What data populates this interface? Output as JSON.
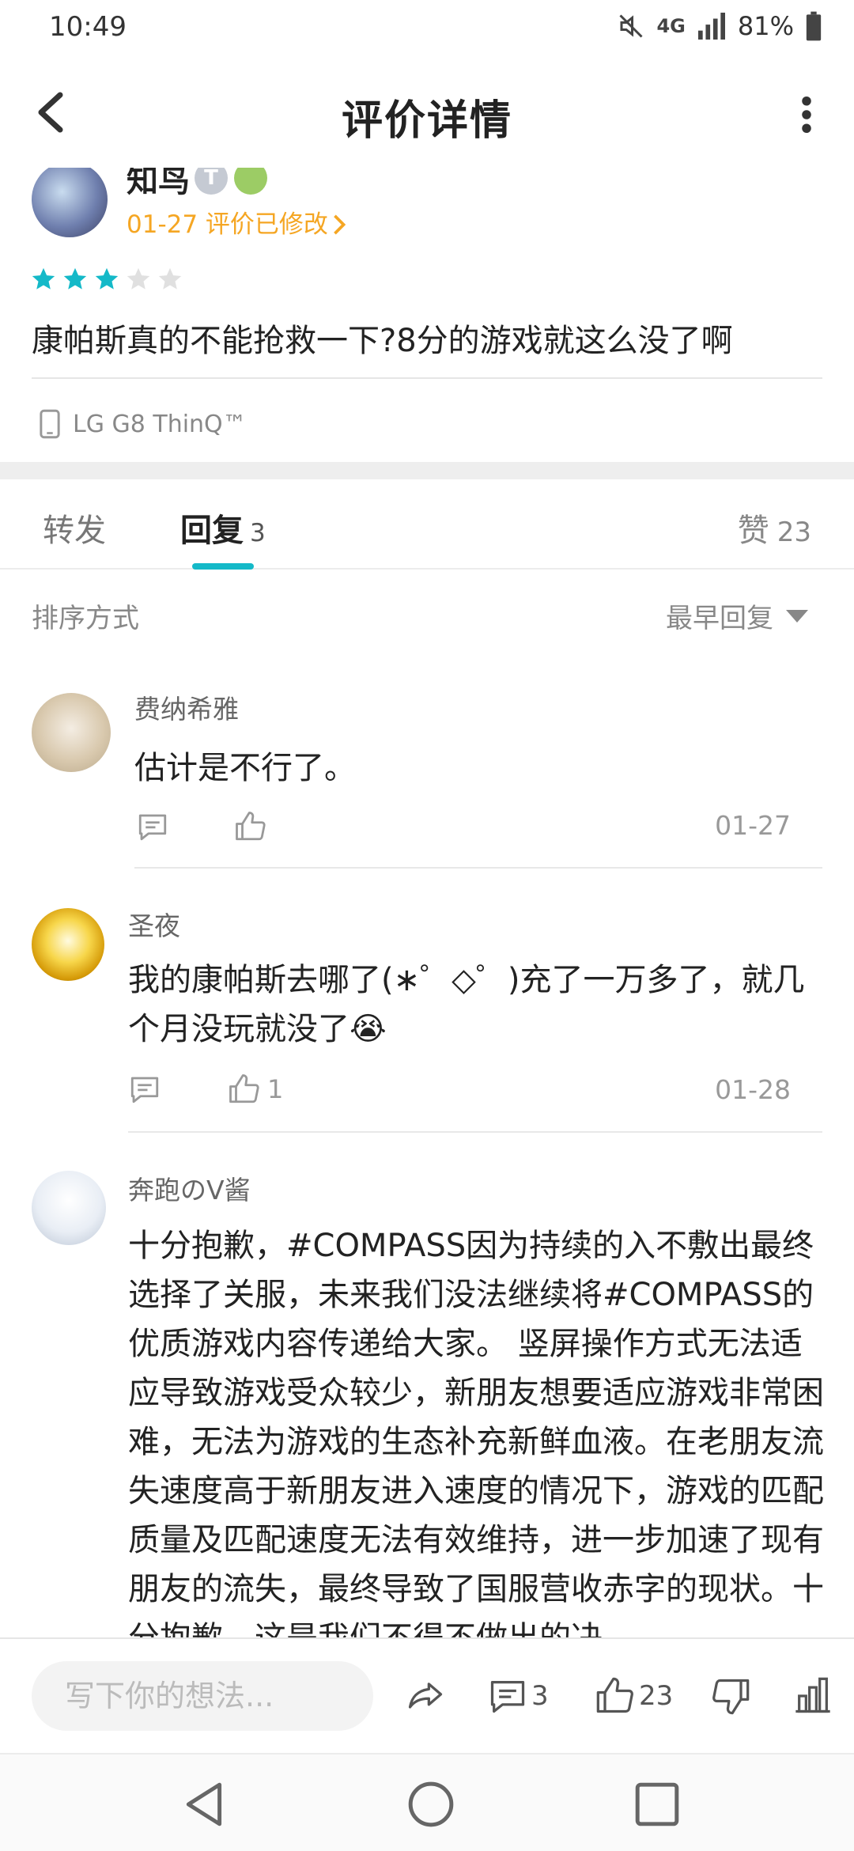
{
  "status_bar": {
    "time": "10:49",
    "network": "4G",
    "battery": "81%"
  },
  "header": {
    "title": "评价详情"
  },
  "review": {
    "author": "知鸟",
    "badge_letter": "T",
    "meta": "01-27 评价已修改",
    "rating": 3,
    "rating_max": 5,
    "content": "康帕斯真的不能抢救一下?8分的游戏就这么没了啊",
    "device": "LG G8 ThinQ™"
  },
  "tabs": {
    "repost_label": "转发",
    "reply_label": "回复",
    "reply_count": "3",
    "like_label": "赞",
    "like_count": "23"
  },
  "sort": {
    "label": "排序方式",
    "value": "最早回复"
  },
  "replies": [
    {
      "name": "费纳希雅",
      "text": "估计是不行了。",
      "like_count": "",
      "date": "01-27"
    },
    {
      "name": "圣夜",
      "text": "我的康帕斯去哪了(∗゜◇゜)充了一万多了，就几个月没玩就没了😭",
      "like_count": "1",
      "date": "01-28"
    },
    {
      "name": "奔跑のV酱",
      "text": "十分抱歉，#COMPASS因为持续的入不敷出最终选择了关服，未来我们没法继续将#COMPASS的优质游戏内容传递给大家。 竖屏操作方式无法适应导致游戏受众较少，新朋友想要适应游戏非常困难，无法为游戏的生态补充新鲜血液。在老朋友流失速度高于新朋友进入速度的情况下，游戏的匹配质量及匹配速度无法有效维持，进一步加速了现有朋友的流失，最终导致了国服营收赤字的现状。十分抱歉，这是我们不得不做出的决"
    }
  ],
  "bottom_bar": {
    "input_placeholder": "写下你的想法...",
    "comment_count": "3",
    "like_count": "23"
  },
  "colors": {
    "accent": "#14b9c8",
    "meta": "#f5a623",
    "star_on": "#14b9c8",
    "star_off": "#e0e0e0"
  },
  "icons": [
    "back-arrow-icon",
    "more-vert-icon",
    "phone-icon",
    "comment-icon",
    "thumb-up-icon",
    "share-icon",
    "thumb-down-icon",
    "chart-icon",
    "nav-back-icon",
    "nav-home-icon",
    "nav-recents-icon"
  ]
}
